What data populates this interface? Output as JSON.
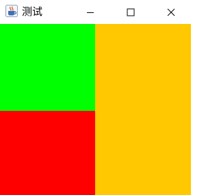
{
  "window": {
    "title": "测试",
    "icon": "java-coffee-cup-icon"
  },
  "controls": {
    "minimize_icon": "minimize-icon",
    "maximize_icon": "maximize-icon",
    "close_icon": "close-icon"
  },
  "panels": [
    {
      "name": "top-left",
      "color": "#00FF00"
    },
    {
      "name": "bottom-left",
      "color": "#FF0000"
    },
    {
      "name": "right",
      "color": "#FFC800"
    }
  ]
}
